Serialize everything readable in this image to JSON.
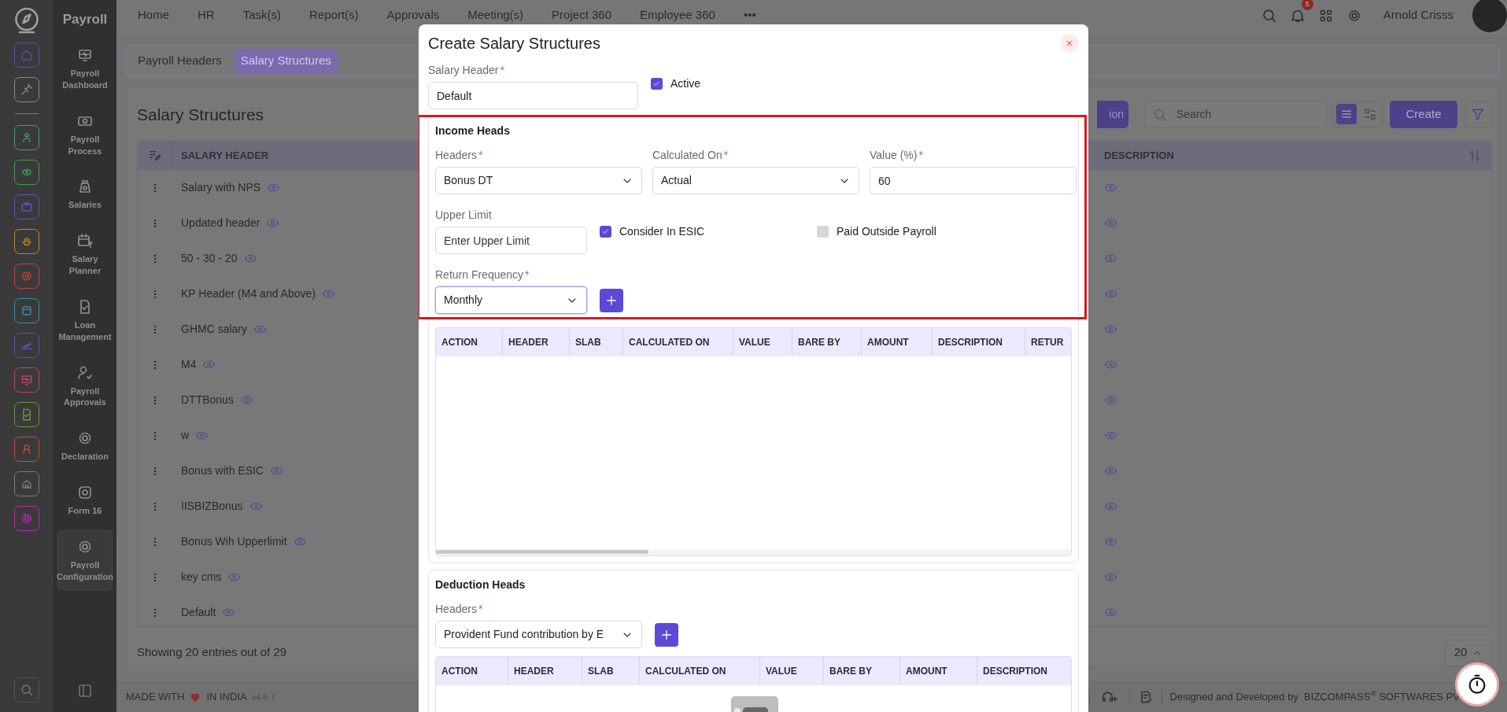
{
  "rail": {
    "top": [
      {
        "color": "#5b4fb0"
      },
      {
        "color": "#8a8a8a"
      }
    ],
    "modules": [
      {
        "color": "#3f9c8c"
      },
      {
        "color": "#3ea04a"
      },
      {
        "color": "#6a4fc0"
      },
      {
        "color": "#c08a2a"
      },
      {
        "color": "#c04444"
      },
      {
        "color": "#3a8fa0"
      },
      {
        "color": "#5a4fb8"
      },
      {
        "color": "#c04460"
      },
      {
        "color": "#5aa040"
      },
      {
        "color": "#c04a3a"
      },
      {
        "color": "#7a7a7a"
      },
      {
        "color": "#b030b0"
      }
    ]
  },
  "app": {
    "title": "Payroll"
  },
  "sidebar": {
    "items": [
      {
        "label": "Payroll Dashboard",
        "selected": false
      },
      {
        "label": "Payroll Process",
        "selected": false
      },
      {
        "label": "Salaries",
        "selected": false
      },
      {
        "label": "Salary Planner",
        "selected": false
      },
      {
        "label": "Loan Management",
        "selected": false
      },
      {
        "label": "Payroll Approvals",
        "selected": false
      },
      {
        "label": "Declaration",
        "selected": false
      },
      {
        "label": "Form 16",
        "selected": false
      },
      {
        "label": "Payroll Configuration",
        "selected": true
      }
    ]
  },
  "topnav": {
    "items": [
      "Home",
      "HR",
      "Task(s)",
      "Report(s)",
      "Approvals",
      "Meeting(s)",
      "Project 360",
      "Employee 360"
    ],
    "more": "•••",
    "notifications": "5",
    "user": "Arnold Crisss"
  },
  "page": {
    "tabs": [
      {
        "label": "Payroll Headers",
        "selected": false
      },
      {
        "label": "Salary Structures",
        "selected": true
      }
    ],
    "title": "Salary Structures",
    "partial_button": "ion",
    "search": {
      "placeholder": "Search"
    },
    "view_toggle": [
      {
        "selected": true
      },
      {
        "selected": false
      }
    ],
    "create": "Create",
    "table": {
      "columns": [
        "SALARY HEADER",
        "DESCRIPTION"
      ],
      "rows": [
        {
          "name": "Salary with NPS"
        },
        {
          "name": "Updated header"
        },
        {
          "name": "50 - 30 - 20"
        },
        {
          "name": "KP Header (M4 and Above)"
        },
        {
          "name": "GHMC salary"
        },
        {
          "name": "M4"
        },
        {
          "name": "DTTBonus"
        },
        {
          "name": "w"
        },
        {
          "name": "Bonus with ESIC"
        },
        {
          "name": "IISBIZBonus"
        },
        {
          "name": "Bonus Wih Upperlimit"
        },
        {
          "name": "key cms"
        },
        {
          "name": "Default"
        }
      ]
    },
    "summary": "Showing 20 entries out of 29",
    "page_size": "20"
  },
  "footer": {
    "made": "MADE WITH",
    "india": "IN INDIA",
    "version": "v4.6.7",
    "credit": "Designed and Developed by  BIZCOMPASS$^{®}$ SOFTWARES PV"
  },
  "modal": {
    "title": "Create Salary Structures",
    "salary_header": {
      "label": "Salary Header",
      "required": "*",
      "value": "Default"
    },
    "active": {
      "label": "Active",
      "checked": true
    },
    "income": {
      "title": "Income Heads",
      "fields": [
        {
          "kind": "select",
          "label": "Headers",
          "required": "*",
          "value": "Bonus DT"
        },
        {
          "kind": "select",
          "label": "Calculated On",
          "required": "*",
          "value": "Actual"
        },
        {
          "kind": "input",
          "label": "Value (%)",
          "required": "*",
          "value": "60"
        }
      ],
      "upper_limit": {
        "label": "Upper Limit",
        "placeholder": "Enter Upper Limit"
      },
      "options": [
        {
          "label": "Consider In ESIC",
          "checked": true
        },
        {
          "label": "Paid Outside Payroll",
          "checked": false
        }
      ],
      "return_frequency": {
        "label": "Return Frequency",
        "required": "*",
        "value": "Monthly",
        "focused": true
      },
      "table": {
        "columns": [
          "ACTION",
          "HEADER",
          "SLAB",
          "CALCULATED ON",
          "VALUE",
          "BARE BY",
          "AMOUNT",
          "DESCRIPTION",
          "RETUR"
        ]
      }
    },
    "deduction": {
      "title": "Deduction Heads",
      "headers": {
        "label": "Headers",
        "required": "*",
        "value": "Provident Fund contribution by E"
      },
      "table": {
        "columns": [
          "ACTION",
          "HEADER",
          "SLAB",
          "CALCULATED ON",
          "VALUE",
          "BARE BY",
          "AMOUNT",
          "DESCRIPTION"
        ]
      }
    }
  }
}
